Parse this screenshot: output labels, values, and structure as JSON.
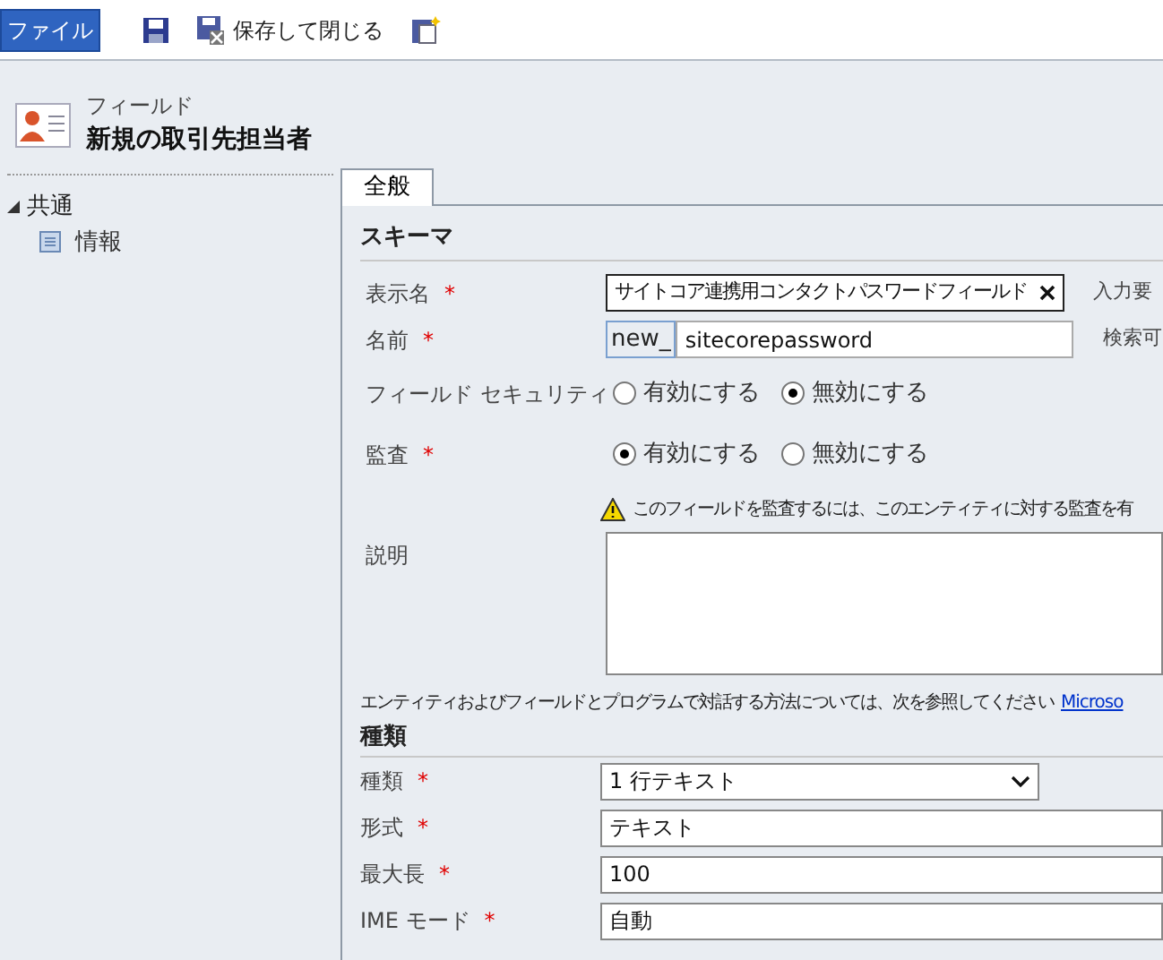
{
  "toolbar": {
    "file_tab": "ファイル",
    "save_close": "保存して閉じる"
  },
  "header": {
    "subtitle": "フィールド",
    "title": "新規の取引先担当者"
  },
  "sidebar": {
    "group": "共通",
    "expanded": true,
    "items": [
      {
        "label": "情報",
        "selected": false
      }
    ]
  },
  "tabs": [
    {
      "label": "全般",
      "selected": true
    }
  ],
  "schema": {
    "heading": "スキーマ",
    "display_name": {
      "label": "表示名",
      "required_mark": "*",
      "value": "サイトコア連携用コンタクトパスワードフィールド",
      "side_label": "入力要"
    },
    "name": {
      "label": "名前",
      "required_mark": "*",
      "prefix": "new_",
      "value": "sitecorepassword",
      "side_label": "検索可"
    },
    "radios": [
      {
        "label": "フィールド セキュリティ",
        "options": [
          {
            "label": "有効にする",
            "selected": false
          },
          {
            "label": "無効にする",
            "selected": true
          }
        ]
      },
      {
        "label": "監査",
        "required_mark": "*",
        "options": [
          {
            "label": "有効にする",
            "selected": true
          },
          {
            "label": "無効にする",
            "selected": false
          }
        ]
      }
    ],
    "warning": "このフィールドを監査するには、このエンティティに対する監査を有",
    "description": {
      "label": "説明"
    },
    "info": "エンティティおよびフィールドとプログラムで対話する方法については、次を参照してください",
    "info_link": "Microso"
  },
  "type_section": {
    "heading": "種類",
    "fields": [
      {
        "kind": "select",
        "label": "種類",
        "required_mark": "*",
        "value": "1 行テキスト"
      },
      {
        "kind": "text",
        "label": "形式",
        "required_mark": "*",
        "value": "テキスト"
      },
      {
        "kind": "text",
        "label": "最大長",
        "required_mark": "*",
        "value": "100"
      },
      {
        "kind": "text",
        "label": "IME モード",
        "required_mark": "*",
        "value": "自動"
      }
    ]
  }
}
